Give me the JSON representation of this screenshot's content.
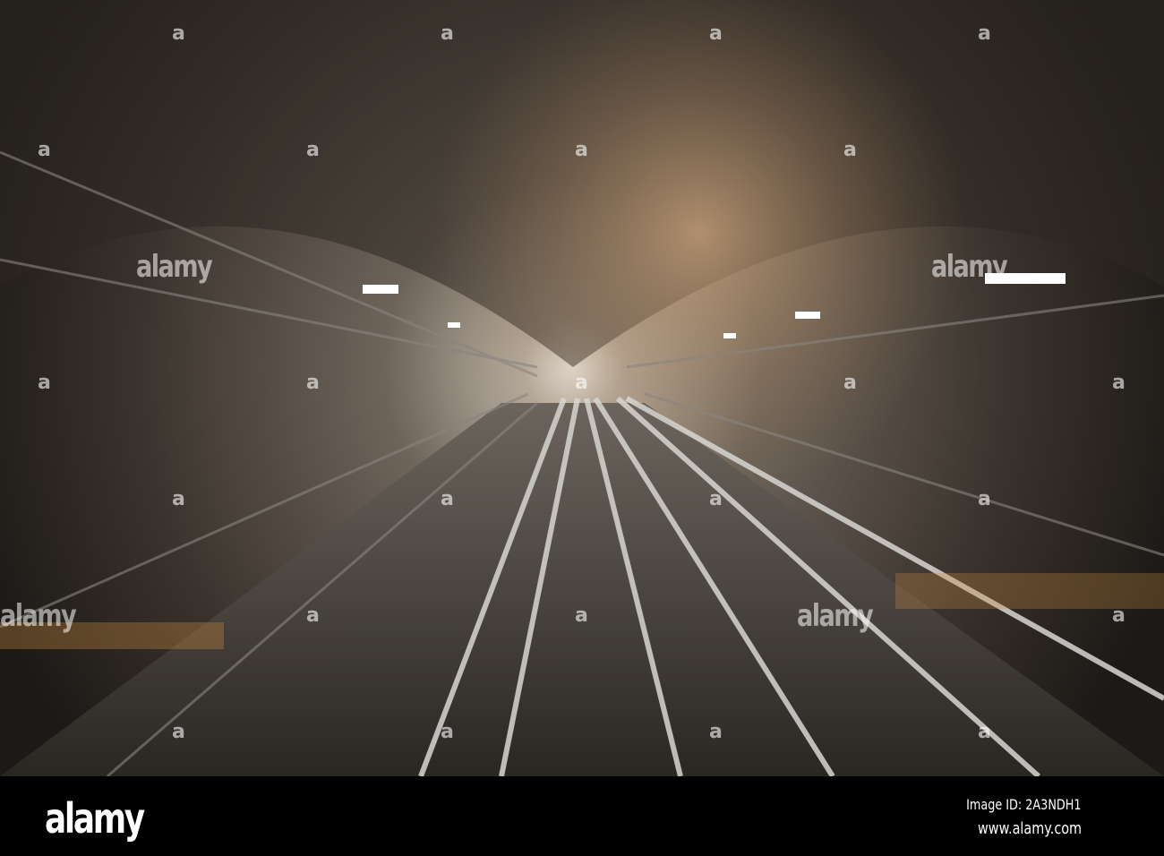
{
  "watermark": {
    "text": "alamy",
    "marker": "a"
  },
  "footer": {
    "logo": "alamy",
    "image_id": "Image ID: 2A3NDH1",
    "url": "www.alamy.com"
  }
}
